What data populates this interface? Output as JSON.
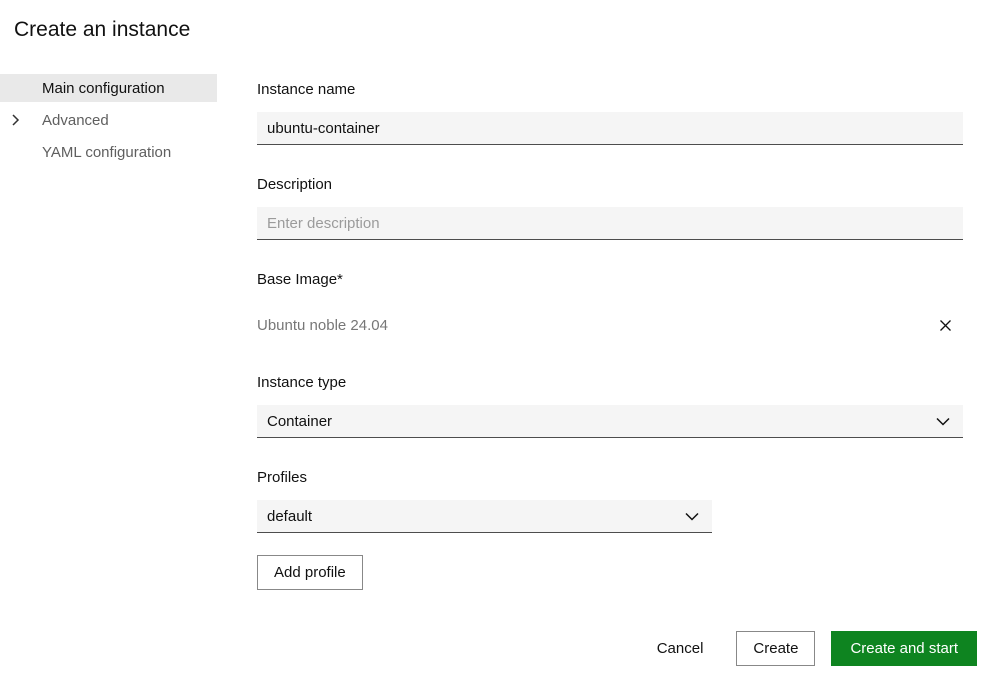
{
  "page": {
    "title": "Create an instance"
  },
  "sidebar": {
    "items": [
      {
        "label": "Main configuration",
        "active": true
      },
      {
        "label": "Advanced",
        "has_chevron": true
      },
      {
        "label": "YAML configuration"
      }
    ]
  },
  "form": {
    "instance_name": {
      "label": "Instance name",
      "value": "ubuntu-container"
    },
    "description": {
      "label": "Description",
      "placeholder": "Enter description"
    },
    "base_image": {
      "label": "Base Image*",
      "value": "Ubuntu noble 24.04"
    },
    "instance_type": {
      "label": "Instance type",
      "selected": "Container"
    },
    "profiles": {
      "label": "Profiles",
      "selected": "default",
      "add_button_label": "Add profile"
    }
  },
  "footer": {
    "cancel_label": "Cancel",
    "create_label": "Create",
    "create_and_start_label": "Create and start"
  },
  "colors": {
    "positive_green": "#0e8420",
    "input_background": "#f5f5f5",
    "sidebar_active_background": "#e9e9e9",
    "text_dark": "#111111",
    "text_muted": "#5f5f5f",
    "placeholder": "#9b9b9b"
  }
}
